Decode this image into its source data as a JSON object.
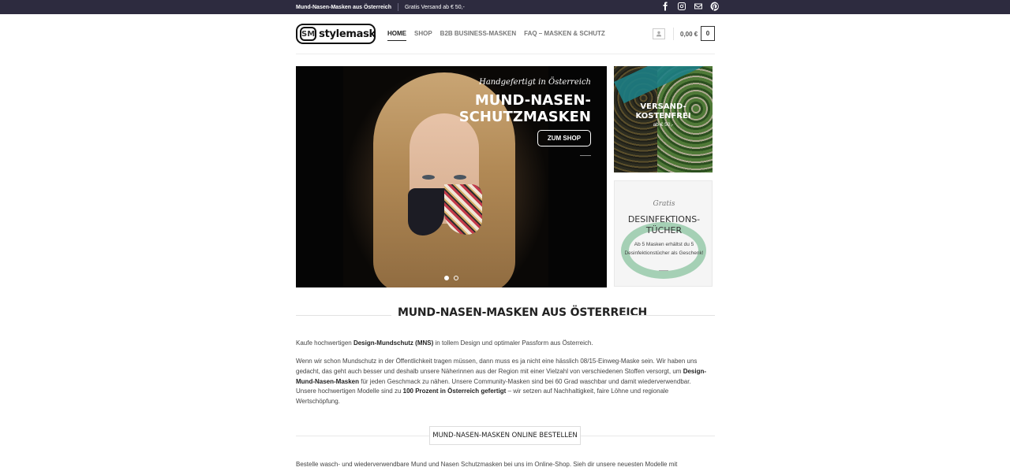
{
  "topbar": {
    "title": "Mund-Nasen-Masken aus Österreich",
    "shipping": "Gratis Versand ab € 50,-",
    "social": [
      "facebook-icon",
      "instagram-icon",
      "mail-icon",
      "pinterest-icon"
    ],
    "background": "#2d2b3f"
  },
  "header": {
    "logo_badge": "SM",
    "logo_text": "stylemask",
    "nav": [
      {
        "label": "HOME",
        "active": true
      },
      {
        "label": "SHOP",
        "active": false
      },
      {
        "label": "B2B BUSINESS-MASKEN",
        "active": false
      },
      {
        "label": "FAQ – MASKEN & SCHUTZ",
        "active": false
      }
    ],
    "cart_total": "0,00 €",
    "cart_count": "0"
  },
  "hero": {
    "script_text": "Handgefertigt in Österreich",
    "title": "MUND-NASEN-SCHUTZMASKEN",
    "button_label": "ZUM SHOP",
    "slide_count": 2,
    "active_slide": 1
  },
  "promos": {
    "shipping": {
      "title": "VERSAND-KOSTENFREI",
      "subtitle": "ab € 50,-"
    },
    "disinfection": {
      "script": "Gratis",
      "title": "DESINFEKTIONS-TÜCHER",
      "text": "Ab 5 Masken erhältst du 5 Desinfektionstücher als Geschenk!"
    }
  },
  "main": {
    "section_title": "MUND-NASEN-MASKEN AUS ÖSTERREICH",
    "intro_before": "Kaufe hochwertigen ",
    "intro_bold": "Design-Mundschutz (MNS)",
    "intro_after": " in tollem Design und optimaler Passform aus Österreich.",
    "p2_a": "Wenn wir schon Mundschutz in der Öffentlichkeit tragen müssen, dann muss es ja nicht eine hässlich 08/15-Einweg-Maske sein. Wir haben uns gedacht, das geht auch besser und deshalb unsere Näherinnen aus der Region mit einer Vielzahl von verschiedenen Stoffen versorgt, um ",
    "p2_bold": "Design-Mund-Nasen-Masken",
    "p2_b": " für jeden Geschmack zu nähen. Unsere Community-Masken sind bei 60 Grad waschbar und damit wiederverwendbar.",
    "p3_a": "Unsere hochwertigen Modelle  sind zu ",
    "p3_bold": "100 Prozent in Österreich gefertigt",
    "p3_b": " – wir setzen auf Nachhaltigkeit, faire Löhne und regionale Wertschöpfung.",
    "order_button": "MUND-NASEN-MASKEN ONLINE BESTELLEN",
    "bottom_text": "Bestelle wasch- und wiederverwendbare Mund und Nasen Schutzmasken bei uns im Online-Shop. Sieh dir unsere neuesten Modelle mit"
  }
}
